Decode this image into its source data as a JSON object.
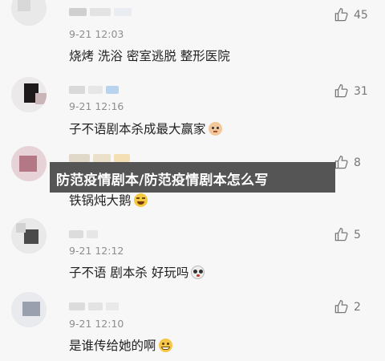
{
  "banner": {
    "title": "防范疫情剧本/防范疫情剧本怎么写"
  },
  "comments": [
    {
      "time": "9-21 12:03",
      "text": "烧烤 洗浴 密室逃脱 整形医院",
      "likes": "45",
      "emoji": ""
    },
    {
      "time": "9-21 12:16",
      "text": "子不语剧本杀成最大赢家",
      "likes": "31",
      "emoji": "cat-face-emoji"
    },
    {
      "time": "",
      "text": "铁锅炖大鹅",
      "likes": "8",
      "emoji": "laughing-emoji"
    },
    {
      "time": "9-21 12:12",
      "text": "子不语 剧本杀 好玩吗",
      "likes": "5",
      "emoji": "panda-face-emoji"
    },
    {
      "time": "9-21 12:10",
      "text": "是谁传给她的啊",
      "likes": "2",
      "emoji": "grinning-emoji"
    }
  ],
  "colors": {
    "background": "#f7f7f7",
    "text": "#222222",
    "meta": "#8e8e8e",
    "banner": "#282828"
  }
}
